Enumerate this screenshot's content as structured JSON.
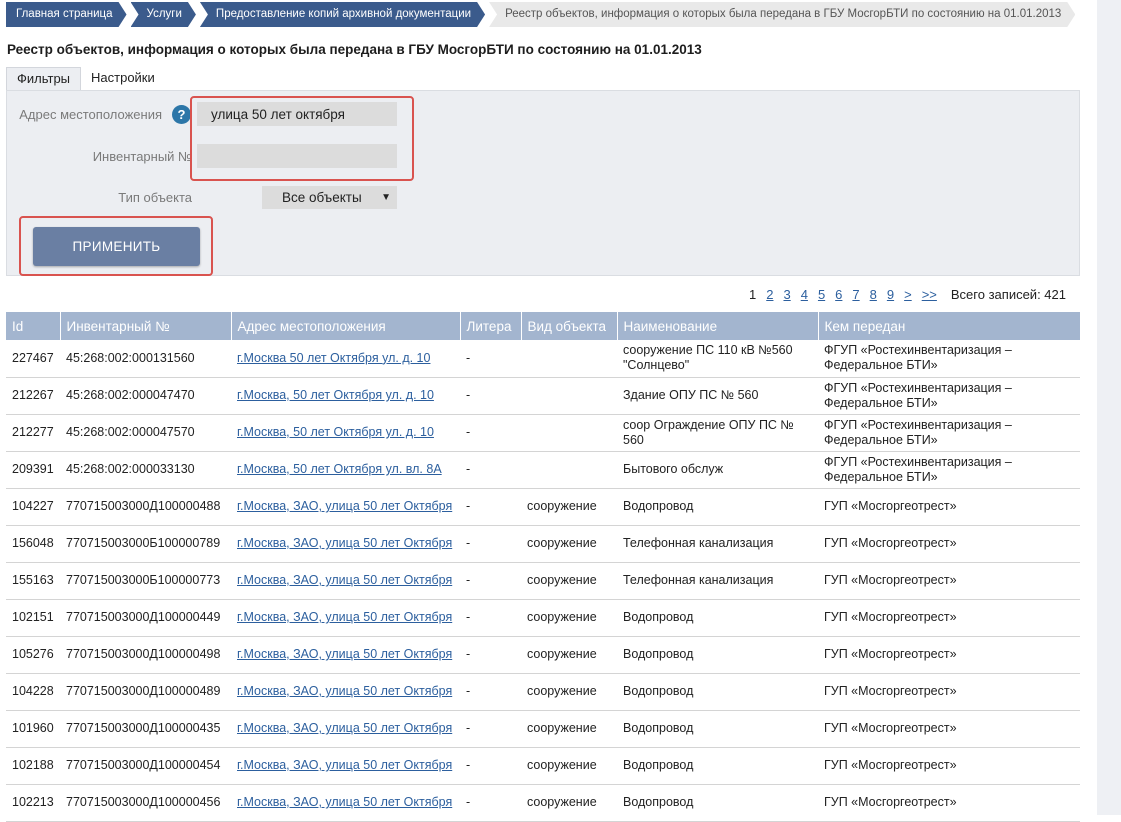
{
  "breadcrumbs": [
    "Главная страница",
    "Услуги",
    "Предоставление копий архивной документации",
    "Реестр объектов, информация о которых была передана в ГБУ МосгорБТИ по состоянию на 01.01.2013"
  ],
  "page_title": "Реестр объектов, информация о которых была передана в ГБУ МосгорБТИ по состоянию на 01.01.2013",
  "tabs": [
    "Фильтры",
    "Настройки"
  ],
  "filters": {
    "address_label": "Адрес местоположения",
    "address_value": "улица 50 лет октября",
    "inventory_label": "Инвентарный №",
    "inventory_value": "",
    "type_label": "Тип объекта",
    "type_value": "Все объекты",
    "apply_label": "ПРИМЕНИТЬ",
    "help_icon": "?"
  },
  "pagination": {
    "current": "1",
    "pages": [
      "2",
      "3",
      "4",
      "5",
      "6",
      "7",
      "8",
      "9",
      ">",
      ">>"
    ],
    "total": "Всего записей: 421"
  },
  "table": {
    "headers": [
      "Id",
      "Инвентарный №",
      "Адрес местоположения",
      "Литера",
      "Вид объекта",
      "Наименование",
      "Кем передан"
    ],
    "rows": [
      {
        "id": "227467",
        "inv": "45:268:002:000131560",
        "addr": "г.Москва 50 лет Октября ул. д. 10",
        "lit": "-",
        "type": "",
        "name": "сооружение ПС 110 кВ №560 \"Солнцево\"",
        "by": "ФГУП «Ростехинвентаризация – Федеральное БТИ»"
      },
      {
        "id": "212267",
        "inv": "45:268:002:000047470",
        "addr": "г.Москва, 50 лет Октября ул. д. 10",
        "lit": "-",
        "type": "",
        "name": "Здание ОПУ ПС № 560",
        "by": "ФГУП «Ростехинвентаризация – Федеральное БТИ»"
      },
      {
        "id": "212277",
        "inv": "45:268:002:000047570",
        "addr": "г.Москва, 50 лет Октября ул. д. 10",
        "lit": "-",
        "type": "",
        "name": "соор Ограждение ОПУ ПС № 560",
        "by": "ФГУП «Ростехинвентаризация – Федеральное БТИ»"
      },
      {
        "id": "209391",
        "inv": "45:268:002:000033130",
        "addr": "г.Москва, 50 лет Октября ул. вл. 8А",
        "lit": "-",
        "type": "",
        "name": "Бытового обслуж",
        "by": "ФГУП «Ростехинвентаризация – Федеральное БТИ»"
      },
      {
        "id": "104227",
        "inv": "770715003000Д100000488",
        "addr": "г.Москва, ЗАО, улица 50 лет Октября",
        "lit": "-",
        "type": "сооружение",
        "name": "Водопровод",
        "by": "ГУП «Мосгоргеотрест»"
      },
      {
        "id": "156048",
        "inv": "770715003000Б100000789",
        "addr": "г.Москва, ЗАО, улица 50 лет Октября",
        "lit": "-",
        "type": "сооружение",
        "name": "Телефонная канализация",
        "by": "ГУП «Мосгоргеотрест»"
      },
      {
        "id": "155163",
        "inv": "770715003000Б100000773",
        "addr": "г.Москва, ЗАО, улица 50 лет Октября",
        "lit": "-",
        "type": "сооружение",
        "name": "Телефонная канализация",
        "by": "ГУП «Мосгоргеотрест»"
      },
      {
        "id": "102151",
        "inv": "770715003000Д100000449",
        "addr": "г.Москва, ЗАО, улица 50 лет Октября",
        "lit": "-",
        "type": "сооружение",
        "name": "Водопровод",
        "by": "ГУП «Мосгоргеотрест»"
      },
      {
        "id": "105276",
        "inv": "770715003000Д100000498",
        "addr": "г.Москва, ЗАО, улица 50 лет Октября",
        "lit": "-",
        "type": "сооружение",
        "name": "Водопровод",
        "by": "ГУП «Мосгоргеотрест»"
      },
      {
        "id": "104228",
        "inv": "770715003000Д100000489",
        "addr": "г.Москва, ЗАО, улица 50 лет Октября",
        "lit": "-",
        "type": "сооружение",
        "name": "Водопровод",
        "by": "ГУП «Мосгоргеотрест»"
      },
      {
        "id": "101960",
        "inv": "770715003000Д100000435",
        "addr": "г.Москва, ЗАО, улица 50 лет Октября",
        "lit": "-",
        "type": "сооружение",
        "name": "Водопровод",
        "by": "ГУП «Мосгоргеотрест»"
      },
      {
        "id": "102188",
        "inv": "770715003000Д100000454",
        "addr": "г.Москва, ЗАО, улица 50 лет Октября",
        "lit": "-",
        "type": "сооружение",
        "name": "Водопровод",
        "by": "ГУП «Мосгоргеотрест»"
      },
      {
        "id": "102213",
        "inv": "770715003000Д100000456",
        "addr": "г.Москва, ЗАО, улица 50 лет Октября",
        "lit": "-",
        "type": "сооружение",
        "name": "Водопровод",
        "by": "ГУП «Мосгоргеотрест»"
      }
    ]
  }
}
